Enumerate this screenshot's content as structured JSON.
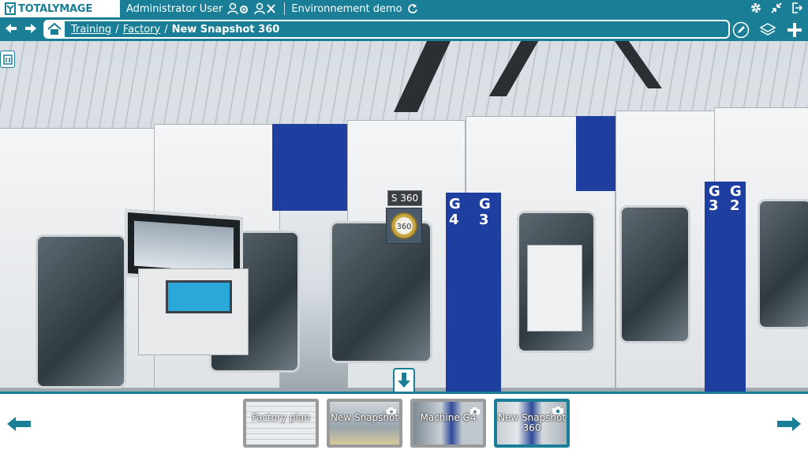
{
  "app": {
    "brand": "TOTALYMAGE",
    "user": "Administrator User",
    "environment": "Environnement demo"
  },
  "breadcrumb": {
    "items": [
      "Training",
      "Factory"
    ],
    "current": "New Snapshot 360",
    "separator": "/"
  },
  "viewer": {
    "hotspot_label": "S 360",
    "hotspot_badge": "360",
    "panel_labels": [
      "G",
      "4",
      "G",
      "3",
      "G",
      "3",
      "G",
      "2"
    ]
  },
  "thumbnails": [
    {
      "label": "Factory plan",
      "has_camera": false,
      "active": false
    },
    {
      "label": "New Snapshot",
      "has_camera": true,
      "active": false
    },
    {
      "label": "Machine G4",
      "has_camera": true,
      "active": false
    },
    {
      "label": "New Snapshot 360",
      "has_camera": true,
      "active": true
    }
  ],
  "colors": {
    "accent": "#1a7f96",
    "panel_blue": "#1f3fa0"
  },
  "icons": {
    "user_settings": "user-settings-icon",
    "user_logout": "user-logout-icon",
    "refresh": "refresh-icon",
    "settings": "gear-icon",
    "collapse": "collapse-icon",
    "logout": "exit-icon",
    "back": "arrow-left-icon",
    "forward": "arrow-right-icon",
    "home": "home-icon",
    "edit": "edit-icon",
    "layers": "layers-icon",
    "add": "plus-icon"
  }
}
